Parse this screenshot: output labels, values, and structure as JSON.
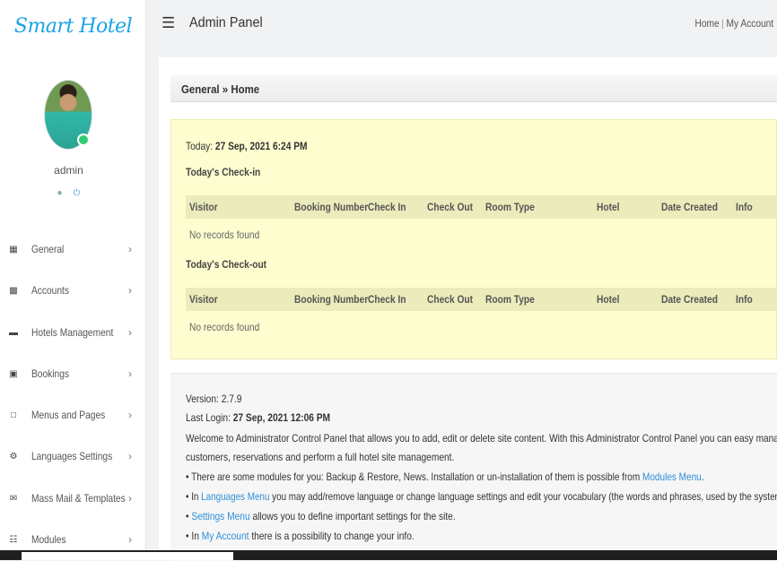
{
  "brand": {
    "name": "Smart Hotel",
    "color": "#1aa3e6"
  },
  "user": {
    "name": "admin",
    "status_color": "#2ecc71"
  },
  "sidebar": {
    "items": [
      {
        "label": "General",
        "icon": "grid-icon"
      },
      {
        "label": "Accounts",
        "icon": "id-card-icon"
      },
      {
        "label": "Hotels Management",
        "icon": "bed-icon"
      },
      {
        "label": "Bookings",
        "icon": "book-icon"
      },
      {
        "label": "Menus and Pages",
        "icon": "page-icon"
      },
      {
        "label": "Languages Settings",
        "icon": "gear-icon"
      },
      {
        "label": "Mass Mail & Templates",
        "icon": "envelope-icon"
      },
      {
        "label": "Modules",
        "icon": "modules-icon"
      }
    ]
  },
  "header": {
    "title": "Admin Panel",
    "links": {
      "home": "Home",
      "separator": "|",
      "account": "My Account"
    }
  },
  "breadcrumb": "General » Home",
  "today": {
    "label": "Today:",
    "value": "27 Sep, 2021 6:24 PM"
  },
  "checkin": {
    "title": "Today's Check-in",
    "empty": "No records found"
  },
  "checkout": {
    "title": "Today's Check-out",
    "empty": "No records found"
  },
  "table_columns": [
    "Visitor",
    "Booking Number",
    "Check In",
    "Check Out",
    "Room Type",
    "Hotel",
    "Date Created",
    "Info"
  ],
  "info": {
    "version": "Version: 2.7.9",
    "last_login_label": "Last Login:",
    "last_login_value": "27 Sep, 2021 12:06 PM",
    "welcome_1": "Welcome to Administrator Control Panel that allows you to add, edit or delete site content. With this Administrator Control Panel you can easy manage",
    "welcome_2": "customers, reservations and perform a full hotel site management.",
    "b1_pre": "• There are some modules for you: Backup & Restore, News. Installation or un-installation of them is possible from ",
    "b1_link": "Modules Menu",
    "b1_post": ".",
    "b2_pre": "• In ",
    "b2_link": "Languages Menu",
    "b2_post": " you may add/remove language or change language settings and edit your vocabulary (the words and phrases, used by the system).",
    "b3_pre": "• ",
    "b3_link": "Settings Menu",
    "b3_post": " allows you to define important settings for the site.",
    "b4_pre": "• In ",
    "b4_link": "My Account",
    "b4_post": " there is a possibility to change your info."
  }
}
